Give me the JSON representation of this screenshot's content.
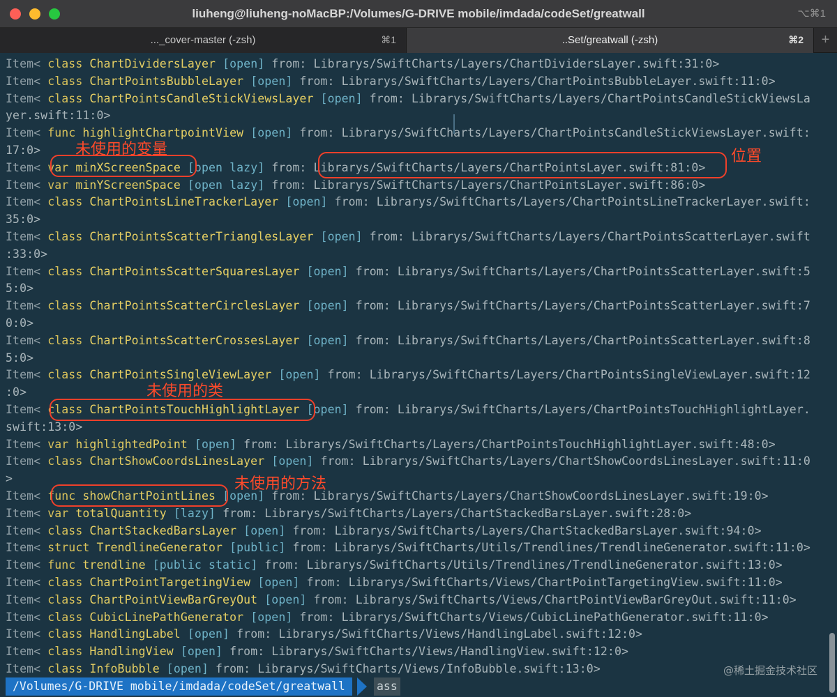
{
  "window": {
    "title": "liuheng@liuheng-noMacBP:/Volumes/G-DRIVE mobile/imdada/codeSet/greatwall",
    "shortcut": "⌥⌘1"
  },
  "tabs": [
    {
      "label": "..._cover-master (-zsh)",
      "key": "⌘1"
    },
    {
      "label": "..Set/greatwall (-zsh)",
      "key": "⌘2"
    }
  ],
  "new_tab": "+",
  "lines": [
    [
      [
        "Item< ",
        "ind"
      ],
      [
        "class ",
        "kw"
      ],
      [
        "ChartDividersLayer ",
        "nm"
      ],
      [
        "[open]",
        "tg"
      ],
      [
        " from: Librarys/SwiftCharts/Layers/ChartDividersLayer.swift:31:0>",
        "tx"
      ]
    ],
    [
      [
        "Item< ",
        "ind"
      ],
      [
        "class ",
        "kw"
      ],
      [
        "ChartPointsBubbleLayer ",
        "nm"
      ],
      [
        "[open]",
        "tg"
      ],
      [
        " from: Librarys/SwiftCharts/Layers/ChartPointsBubbleLayer.swift:11:0>",
        "tx"
      ]
    ],
    [
      [
        "Item< ",
        "ind"
      ],
      [
        "class ",
        "kw"
      ],
      [
        "ChartPointsCandleStickViewsLayer ",
        "nm"
      ],
      [
        "[open]",
        "tg"
      ],
      [
        " from: Librarys/SwiftCharts/Layers/ChartPointsCandleStickViewsLa",
        "tx"
      ]
    ],
    [
      [
        "yer.swift:11:0>",
        "tx"
      ]
    ],
    [
      [
        "Item< ",
        "ind"
      ],
      [
        "func ",
        "kw"
      ],
      [
        "highlightChartpointView ",
        "nm"
      ],
      [
        "[open]",
        "tg"
      ],
      [
        " from: Librarys/SwiftCharts/Layers/ChartPointsCandleStickViewsLayer.swift:",
        "tx"
      ]
    ],
    [
      [
        "17:0>",
        "tx"
      ]
    ],
    [
      [
        "Item< ",
        "ind"
      ],
      [
        "var ",
        "kw"
      ],
      [
        "minXScreenSpace ",
        "nm"
      ],
      [
        "[open lazy]",
        "tg"
      ],
      [
        " from: Librarys/SwiftCharts/Layers/ChartPointsLayer.swift:81:0>",
        "tx"
      ]
    ],
    [
      [
        "Item< ",
        "ind"
      ],
      [
        "var ",
        "kw"
      ],
      [
        "minYScreenSpace ",
        "nm"
      ],
      [
        "[open lazy]",
        "tg"
      ],
      [
        " from: Librarys/SwiftCharts/Layers/ChartPointsLayer.swift:86:0>",
        "tx"
      ]
    ],
    [
      [
        "Item< ",
        "ind"
      ],
      [
        "class ",
        "kw"
      ],
      [
        "ChartPointsLineTrackerLayer ",
        "nm"
      ],
      [
        "[open]",
        "tg"
      ],
      [
        " from: Librarys/SwiftCharts/Layers/ChartPointsLineTrackerLayer.swift:",
        "tx"
      ]
    ],
    [
      [
        "35:0>",
        "tx"
      ]
    ],
    [
      [
        "Item< ",
        "ind"
      ],
      [
        "class ",
        "kw"
      ],
      [
        "ChartPointsScatterTrianglesLayer ",
        "nm"
      ],
      [
        "[open]",
        "tg"
      ],
      [
        " from: Librarys/SwiftCharts/Layers/ChartPointsScatterLayer.swift",
        "tx"
      ]
    ],
    [
      [
        ":33:0>",
        "tx"
      ]
    ],
    [
      [
        "Item< ",
        "ind"
      ],
      [
        "class ",
        "kw"
      ],
      [
        "ChartPointsScatterSquaresLayer ",
        "nm"
      ],
      [
        "[open]",
        "tg"
      ],
      [
        " from: Librarys/SwiftCharts/Layers/ChartPointsScatterLayer.swift:5",
        "tx"
      ]
    ],
    [
      [
        "5:0>",
        "tx"
      ]
    ],
    [
      [
        "Item< ",
        "ind"
      ],
      [
        "class ",
        "kw"
      ],
      [
        "ChartPointsScatterCirclesLayer ",
        "nm"
      ],
      [
        "[open]",
        "tg"
      ],
      [
        " from: Librarys/SwiftCharts/Layers/ChartPointsScatterLayer.swift:7",
        "tx"
      ]
    ],
    [
      [
        "0:0>",
        "tx"
      ]
    ],
    [
      [
        "Item< ",
        "ind"
      ],
      [
        "class ",
        "kw"
      ],
      [
        "ChartPointsScatterCrossesLayer ",
        "nm"
      ],
      [
        "[open]",
        "tg"
      ],
      [
        " from: Librarys/SwiftCharts/Layers/ChartPointsScatterLayer.swift:8",
        "tx"
      ]
    ],
    [
      [
        "5:0>",
        "tx"
      ]
    ],
    [
      [
        "Item< ",
        "ind"
      ],
      [
        "class ",
        "kw"
      ],
      [
        "ChartPointsSingleViewLayer ",
        "nm"
      ],
      [
        "[open]",
        "tg"
      ],
      [
        " from: Librarys/SwiftCharts/Layers/ChartPointsSingleViewLayer.swift:12",
        "tx"
      ]
    ],
    [
      [
        ":0>",
        "tx"
      ]
    ],
    [
      [
        "Item< ",
        "ind"
      ],
      [
        "class ",
        "kw"
      ],
      [
        "ChartPointsTouchHighlightLayer ",
        "nm"
      ],
      [
        "[open]",
        "tg"
      ],
      [
        " from: Librarys/SwiftCharts/Layers/ChartPointsTouchHighlightLayer.",
        "tx"
      ]
    ],
    [
      [
        "swift:13:0>",
        "tx"
      ]
    ],
    [
      [
        "Item< ",
        "ind"
      ],
      [
        "var ",
        "kw"
      ],
      [
        "highlightedPoint ",
        "nm"
      ],
      [
        "[open]",
        "tg"
      ],
      [
        " from: Librarys/SwiftCharts/Layers/ChartPointsTouchHighlightLayer.swift:48:0>",
        "tx"
      ]
    ],
    [
      [
        "Item< ",
        "ind"
      ],
      [
        "class ",
        "kw"
      ],
      [
        "ChartShowCoordsLinesLayer ",
        "nm"
      ],
      [
        "[open]",
        "tg"
      ],
      [
        " from: Librarys/SwiftCharts/Layers/ChartShowCoordsLinesLayer.swift:11:0",
        "tx"
      ]
    ],
    [
      [
        ">",
        "tx"
      ]
    ],
    [
      [
        "Item< ",
        "ind"
      ],
      [
        "func ",
        "kw"
      ],
      [
        "showChartPointLines ",
        "nm"
      ],
      [
        "[open]",
        "tg"
      ],
      [
        " from: Librarys/SwiftCharts/Layers/ChartShowCoordsLinesLayer.swift:19:0>",
        "tx"
      ]
    ],
    [
      [
        "Item< ",
        "ind"
      ],
      [
        "var ",
        "kw"
      ],
      [
        "totalQuantity ",
        "nm"
      ],
      [
        "[lazy]",
        "tg"
      ],
      [
        " from: Librarys/SwiftCharts/Layers/ChartStackedBarsLayer.swift:28:0>",
        "tx"
      ]
    ],
    [
      [
        "Item< ",
        "ind"
      ],
      [
        "class ",
        "kw"
      ],
      [
        "ChartStackedBarsLayer ",
        "nm"
      ],
      [
        "[open]",
        "tg"
      ],
      [
        " from: Librarys/SwiftCharts/Layers/ChartStackedBarsLayer.swift:94:0>",
        "tx"
      ]
    ],
    [
      [
        "Item< ",
        "ind"
      ],
      [
        "struct ",
        "kw"
      ],
      [
        "TrendlineGenerator ",
        "nm"
      ],
      [
        "[public]",
        "tg"
      ],
      [
        " from: Librarys/SwiftCharts/Utils/Trendlines/TrendlineGenerator.swift:11:0>",
        "tx"
      ]
    ],
    [
      [
        "Item< ",
        "ind"
      ],
      [
        "func ",
        "kw"
      ],
      [
        "trendline ",
        "nm"
      ],
      [
        "[public static]",
        "tg"
      ],
      [
        " from: Librarys/SwiftCharts/Utils/Trendlines/TrendlineGenerator.swift:13:0>",
        "tx"
      ]
    ],
    [
      [
        "Item< ",
        "ind"
      ],
      [
        "class ",
        "kw"
      ],
      [
        "ChartPointTargetingView ",
        "nm"
      ],
      [
        "[open]",
        "tg"
      ],
      [
        " from: Librarys/SwiftCharts/Views/ChartPointTargetingView.swift:11:0>",
        "tx"
      ]
    ],
    [
      [
        "Item< ",
        "ind"
      ],
      [
        "class ",
        "kw"
      ],
      [
        "ChartPointViewBarGreyOut ",
        "nm"
      ],
      [
        "[open]",
        "tg"
      ],
      [
        " from: Librarys/SwiftCharts/Views/ChartPointViewBarGreyOut.swift:11:0>",
        "tx"
      ]
    ],
    [
      [
        "Item< ",
        "ind"
      ],
      [
        "class ",
        "kw"
      ],
      [
        "CubicLinePathGenerator ",
        "nm"
      ],
      [
        "[open]",
        "tg"
      ],
      [
        " from: Librarys/SwiftCharts/Views/CubicLinePathGenerator.swift:11:0>",
        "tx"
      ]
    ],
    [
      [
        "Item< ",
        "ind"
      ],
      [
        "class ",
        "kw"
      ],
      [
        "HandlingLabel ",
        "nm"
      ],
      [
        "[open]",
        "tg"
      ],
      [
        " from: Librarys/SwiftCharts/Views/HandlingLabel.swift:12:0>",
        "tx"
      ]
    ],
    [
      [
        "Item< ",
        "ind"
      ],
      [
        "class ",
        "kw"
      ],
      [
        "HandlingView ",
        "nm"
      ],
      [
        "[open]",
        "tg"
      ],
      [
        " from: Librarys/SwiftCharts/Views/HandlingView.swift:12:0>",
        "tx"
      ]
    ],
    [
      [
        "Item< ",
        "ind"
      ],
      [
        "class ",
        "kw"
      ],
      [
        "InfoBubble ",
        "nm"
      ],
      [
        "[open]",
        "tg"
      ],
      [
        " from: Librarys/SwiftCharts/Views/InfoBubble.swift:13:0>",
        "tx"
      ]
    ]
  ],
  "annotations": {
    "unused_variable": "未使用的变量",
    "location": "位置",
    "unused_class": "未使用的类",
    "unused_method": "未使用的方法"
  },
  "prompt": {
    "path": "/Volumes/G-DRIVE mobile/imdada/codeSet/greatwall",
    "input": "ass"
  },
  "watermark": "@稀土掘金技术社区",
  "colors": {
    "background": "#1b3442",
    "keyword": "#d9c25a",
    "tag": "#6fb3c8",
    "annotation": "#ff4a2a",
    "prompt_bg": "#1e73c5"
  }
}
